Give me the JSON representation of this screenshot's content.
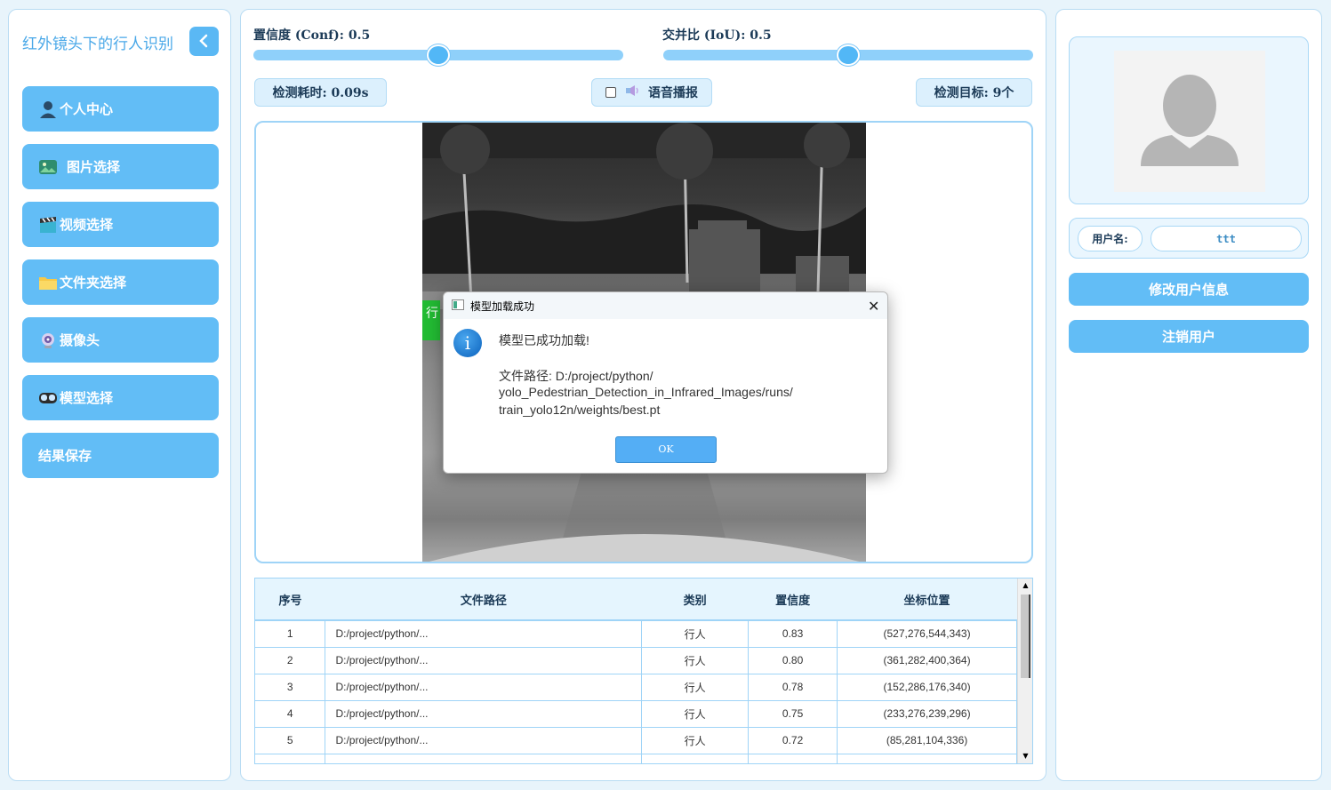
{
  "app": {
    "title": "红外镜头下的行人识别"
  },
  "sidebar": {
    "items": [
      {
        "label": "个人中心",
        "icon": "user-icon"
      },
      {
        "label": "图片选择",
        "icon": "image-icon"
      },
      {
        "label": "视频选择",
        "icon": "clapperboard-icon"
      },
      {
        "label": "文件夹选择",
        "icon": "folder-icon"
      },
      {
        "label": "摄像头",
        "icon": "webcam-icon"
      },
      {
        "label": "模型选择",
        "icon": "vr-headset-icon"
      },
      {
        "label": "结果保存",
        "icon": ""
      }
    ]
  },
  "controls": {
    "conf_label": "置信度 (Conf): 0.5",
    "conf_value": 0.5,
    "iou_label": "交并比 (IoU): 0.5",
    "iou_value": 0.5,
    "detect_time": "检测耗时: 0.09s",
    "voice_label": "语音播报",
    "voice_checked": false,
    "detect_count": "检测目标: 9个"
  },
  "table": {
    "headers": [
      "序号",
      "文件路径",
      "类别",
      "置信度",
      "坐标位置"
    ],
    "rows": [
      [
        "1",
        "D:/project/python/...",
        "行人",
        "0.83",
        "(527,276,544,343)"
      ],
      [
        "2",
        "D:/project/python/...",
        "行人",
        "0.80",
        "(361,282,400,364)"
      ],
      [
        "3",
        "D:/project/python/...",
        "行人",
        "0.78",
        "(152,286,176,340)"
      ],
      [
        "4",
        "D:/project/python/...",
        "行人",
        "0.75",
        "(233,276,239,296)"
      ],
      [
        "5",
        "D:/project/python/...",
        "行人",
        "0.72",
        "(85,281,104,336)"
      ]
    ]
  },
  "user": {
    "label": "用户名:",
    "value": "ttt",
    "edit_button": "修改用户信息",
    "logout_button": "注销用户"
  },
  "dialog": {
    "title": "模型加载成功",
    "message": "模型已成功加载!",
    "path_line1": "文件路径: D:/project/python/",
    "path_line2": "yolo_Pedestrian_Detection_in_Infrared_Images/runs/",
    "path_line3": "train_yolo12n/weights/best.pt",
    "ok": "OK",
    "close": "✕"
  },
  "image_overlay": {
    "label_fragment": "行"
  },
  "colors": {
    "accent": "#62bdf6",
    "panel_bg": "#e8f4fb",
    "border": "#9fd4f7"
  }
}
